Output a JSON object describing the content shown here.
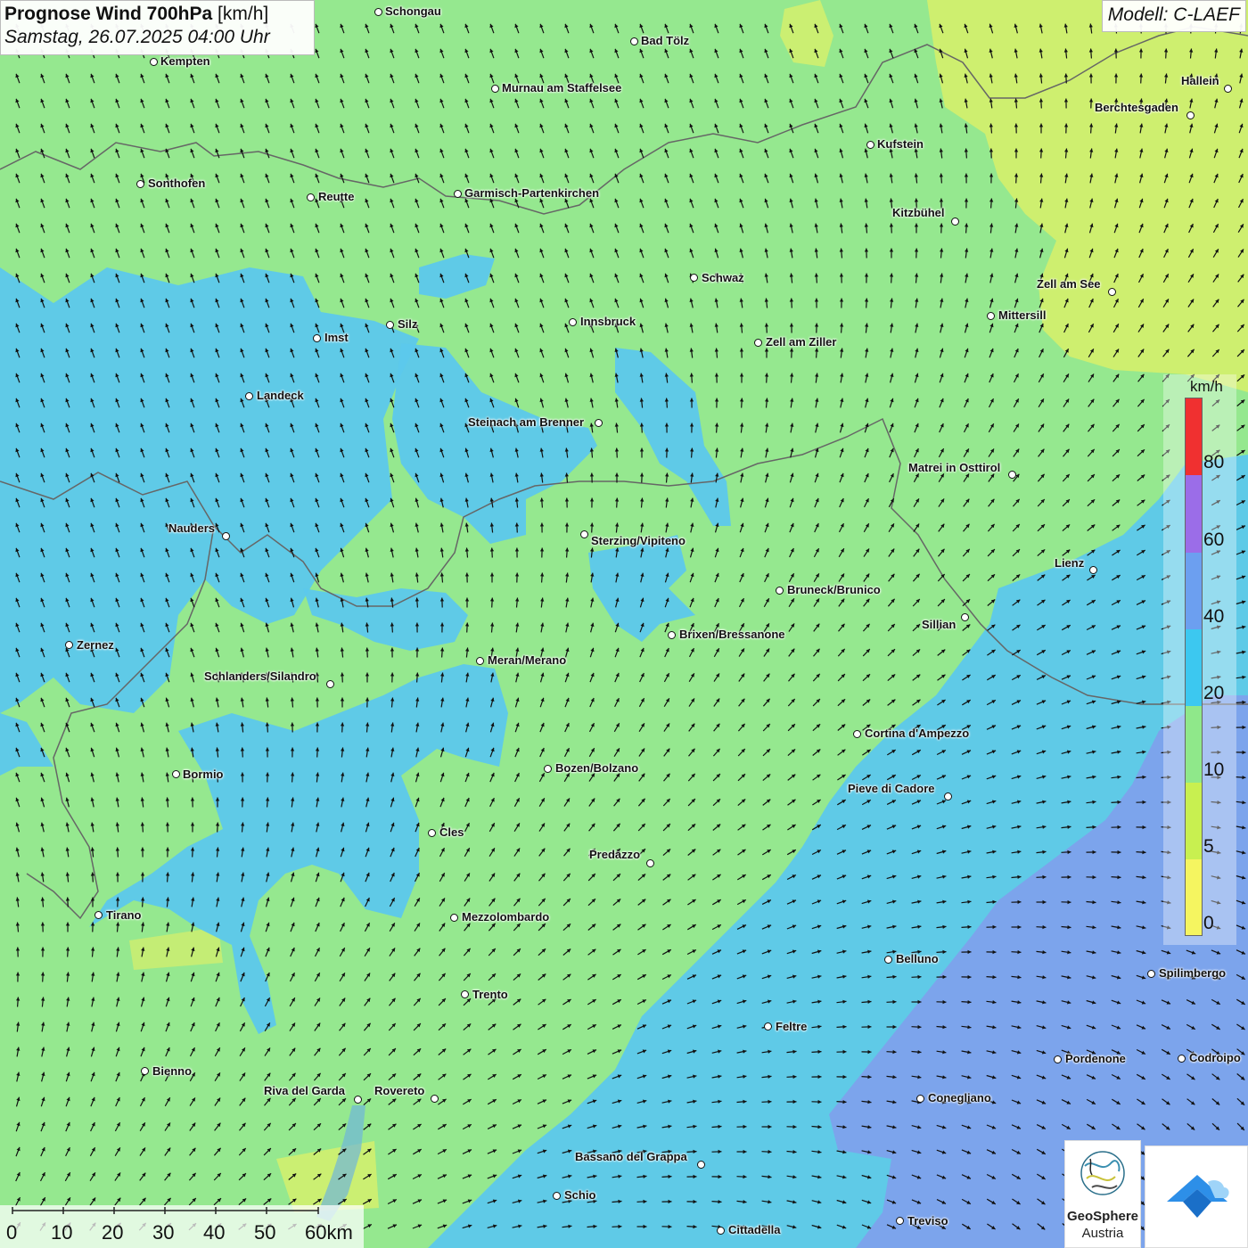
{
  "title": {
    "main": "Prognose Wind 700hPa",
    "unit": "[km/h]",
    "datetime": "Samstag, 26.07.2025 04:00 Uhr"
  },
  "model": "Modell: C-LAEF",
  "legend": {
    "unit": "km/h",
    "labels": [
      "80",
      "60",
      "40",
      "20",
      "10",
      "5",
      "0"
    ],
    "colors": [
      "#f03030",
      "#9b6de8",
      "#6c9ff0",
      "#3cc8f0",
      "#8fe88a",
      "#c8f050",
      "#f5f560"
    ]
  },
  "map_colors": {
    "calm_yellow": "#d8f06a",
    "light_green": "#95e88f",
    "cyan_blue": "#5cc8ec",
    "medium_blue": "#7fa0ec",
    "border": "#666666",
    "arrow": "#111111"
  },
  "cities": [
    {
      "name": "Schongau"
    },
    {
      "name": "Kempten"
    },
    {
      "name": "Bad Tölz"
    },
    {
      "name": "Murnau am Staffelsee"
    },
    {
      "name": "Hallein"
    },
    {
      "name": "Berchtesgaden"
    },
    {
      "name": "Kufstein"
    },
    {
      "name": "Sonthofen"
    },
    {
      "name": "Reutte"
    },
    {
      "name": "Garmisch-Partenkirchen"
    },
    {
      "name": "Kitzbühel"
    },
    {
      "name": "Schwaz"
    },
    {
      "name": "Zell am See"
    },
    {
      "name": "Mittersill"
    },
    {
      "name": "Silz"
    },
    {
      "name": "Innsbruck"
    },
    {
      "name": "Imst"
    },
    {
      "name": "Zell am Ziller"
    },
    {
      "name": "Landeck"
    },
    {
      "name": "Steinach am Brenner"
    },
    {
      "name": "Matrei in Osttirol"
    },
    {
      "name": "Nauders"
    },
    {
      "name": "Sterzing/Vipiteno"
    },
    {
      "name": "Lienz"
    },
    {
      "name": "Bruneck/Brunico"
    },
    {
      "name": "Sillian"
    },
    {
      "name": "Zernez"
    },
    {
      "name": "Brixen/Bressanone"
    },
    {
      "name": "Meran/Merano"
    },
    {
      "name": "Schlanders/Silandro"
    },
    {
      "name": "Cortina d'Ampezzo"
    },
    {
      "name": "Bormio"
    },
    {
      "name": "Bozen/Bolzano"
    },
    {
      "name": "Pieve di Cadore"
    },
    {
      "name": "Cles"
    },
    {
      "name": "Predazzo"
    },
    {
      "name": "Tirano"
    },
    {
      "name": "Mezzolombardo"
    },
    {
      "name": "Belluno"
    },
    {
      "name": "Spilimbergo"
    },
    {
      "name": "Trento"
    },
    {
      "name": "Feltre"
    },
    {
      "name": "Pordenone"
    },
    {
      "name": "Codroipo"
    },
    {
      "name": "Bienno"
    },
    {
      "name": "Riva del Garda"
    },
    {
      "name": "Rovereto"
    },
    {
      "name": "Conegliano"
    },
    {
      "name": "Bassano del Grappa"
    },
    {
      "name": "Schio"
    },
    {
      "name": "Treviso"
    },
    {
      "name": "Cittadella"
    }
  ],
  "scale": {
    "labels": [
      "0",
      "10",
      "20",
      "30",
      "40",
      "50",
      "60km"
    ]
  },
  "logos": {
    "geosphere_line1": "GeoSphere",
    "geosphere_line2": "Austria"
  }
}
